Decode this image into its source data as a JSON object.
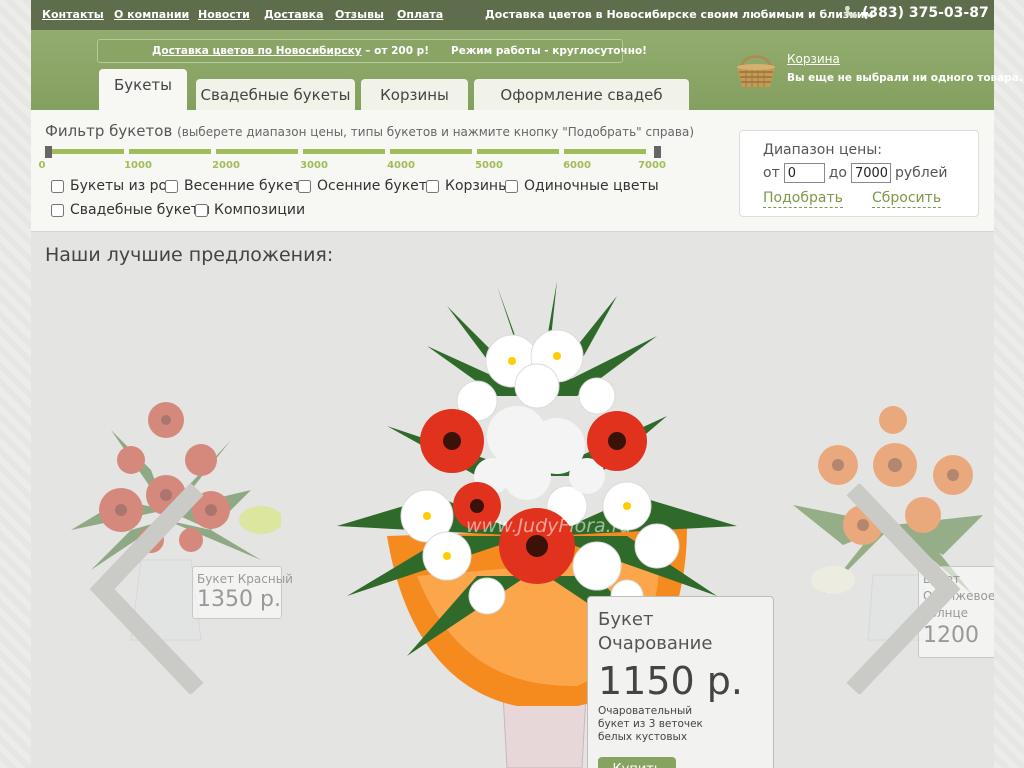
{
  "topnav": {
    "items": [
      "Контакты",
      "О компании",
      "Новости",
      "Доставка",
      "Отзывы",
      "Оплата"
    ],
    "tagline": "Доставка цветов в Новосибирске своим любимым и близким",
    "phone": "(383) 375-03-87"
  },
  "header": {
    "delivery_link": "Доставка цветов по Новосибирску",
    "delivery_price": " – от 200 р!",
    "work_hours": "Режим работы - круглосуточно!",
    "tabs": [
      "Букеты",
      "Свадебные букеты",
      "Корзины",
      "Оформление свадеб"
    ],
    "basket_link": "Корзина",
    "basket_empty": "Вы еще не выбрали ни одного товара."
  },
  "filter": {
    "title": "Фильтр букетов",
    "hint": "(выберете диапазон цены, типы букетов и нажмите кнопку \"Подобрать\" справа)",
    "ticks": [
      "0",
      "1000",
      "2000",
      "3000",
      "4000",
      "5000",
      "6000",
      "7000"
    ],
    "checkboxes": [
      "Букеты из роз",
      "Весенние букеты",
      "Осенние букеты",
      "Корзины",
      "Одиночные цветы",
      "Свадебные букеты",
      "Композиции"
    ],
    "price_range": {
      "title": "Диапазон цены:",
      "from_label": "от",
      "from_value": "0",
      "to_label": "до",
      "to_value": "7000",
      "currency": "рублей",
      "apply": "Подобрать",
      "reset": "Сбросить"
    }
  },
  "offers": {
    "title": "Наши лучшие предложения:",
    "left": {
      "name": "Букет Красный",
      "price": "1350 р."
    },
    "center": {
      "name": "Букет Очарование",
      "price": "1150 р.",
      "description": "Очаровательный букет из 3 веточек белых кустовых",
      "buy": "Купить",
      "watermark": "www.JudyFlora.ru"
    },
    "right": {
      "name_line1": "Букет",
      "name_line2": "Оранжевое",
      "name_line3": "солнце",
      "price": "1200"
    }
  },
  "colors": {
    "topbar": "#5e6e4c",
    "header": "#8aa466",
    "accent_green": "#9fbe5a",
    "link_green": "#7a9a46"
  }
}
